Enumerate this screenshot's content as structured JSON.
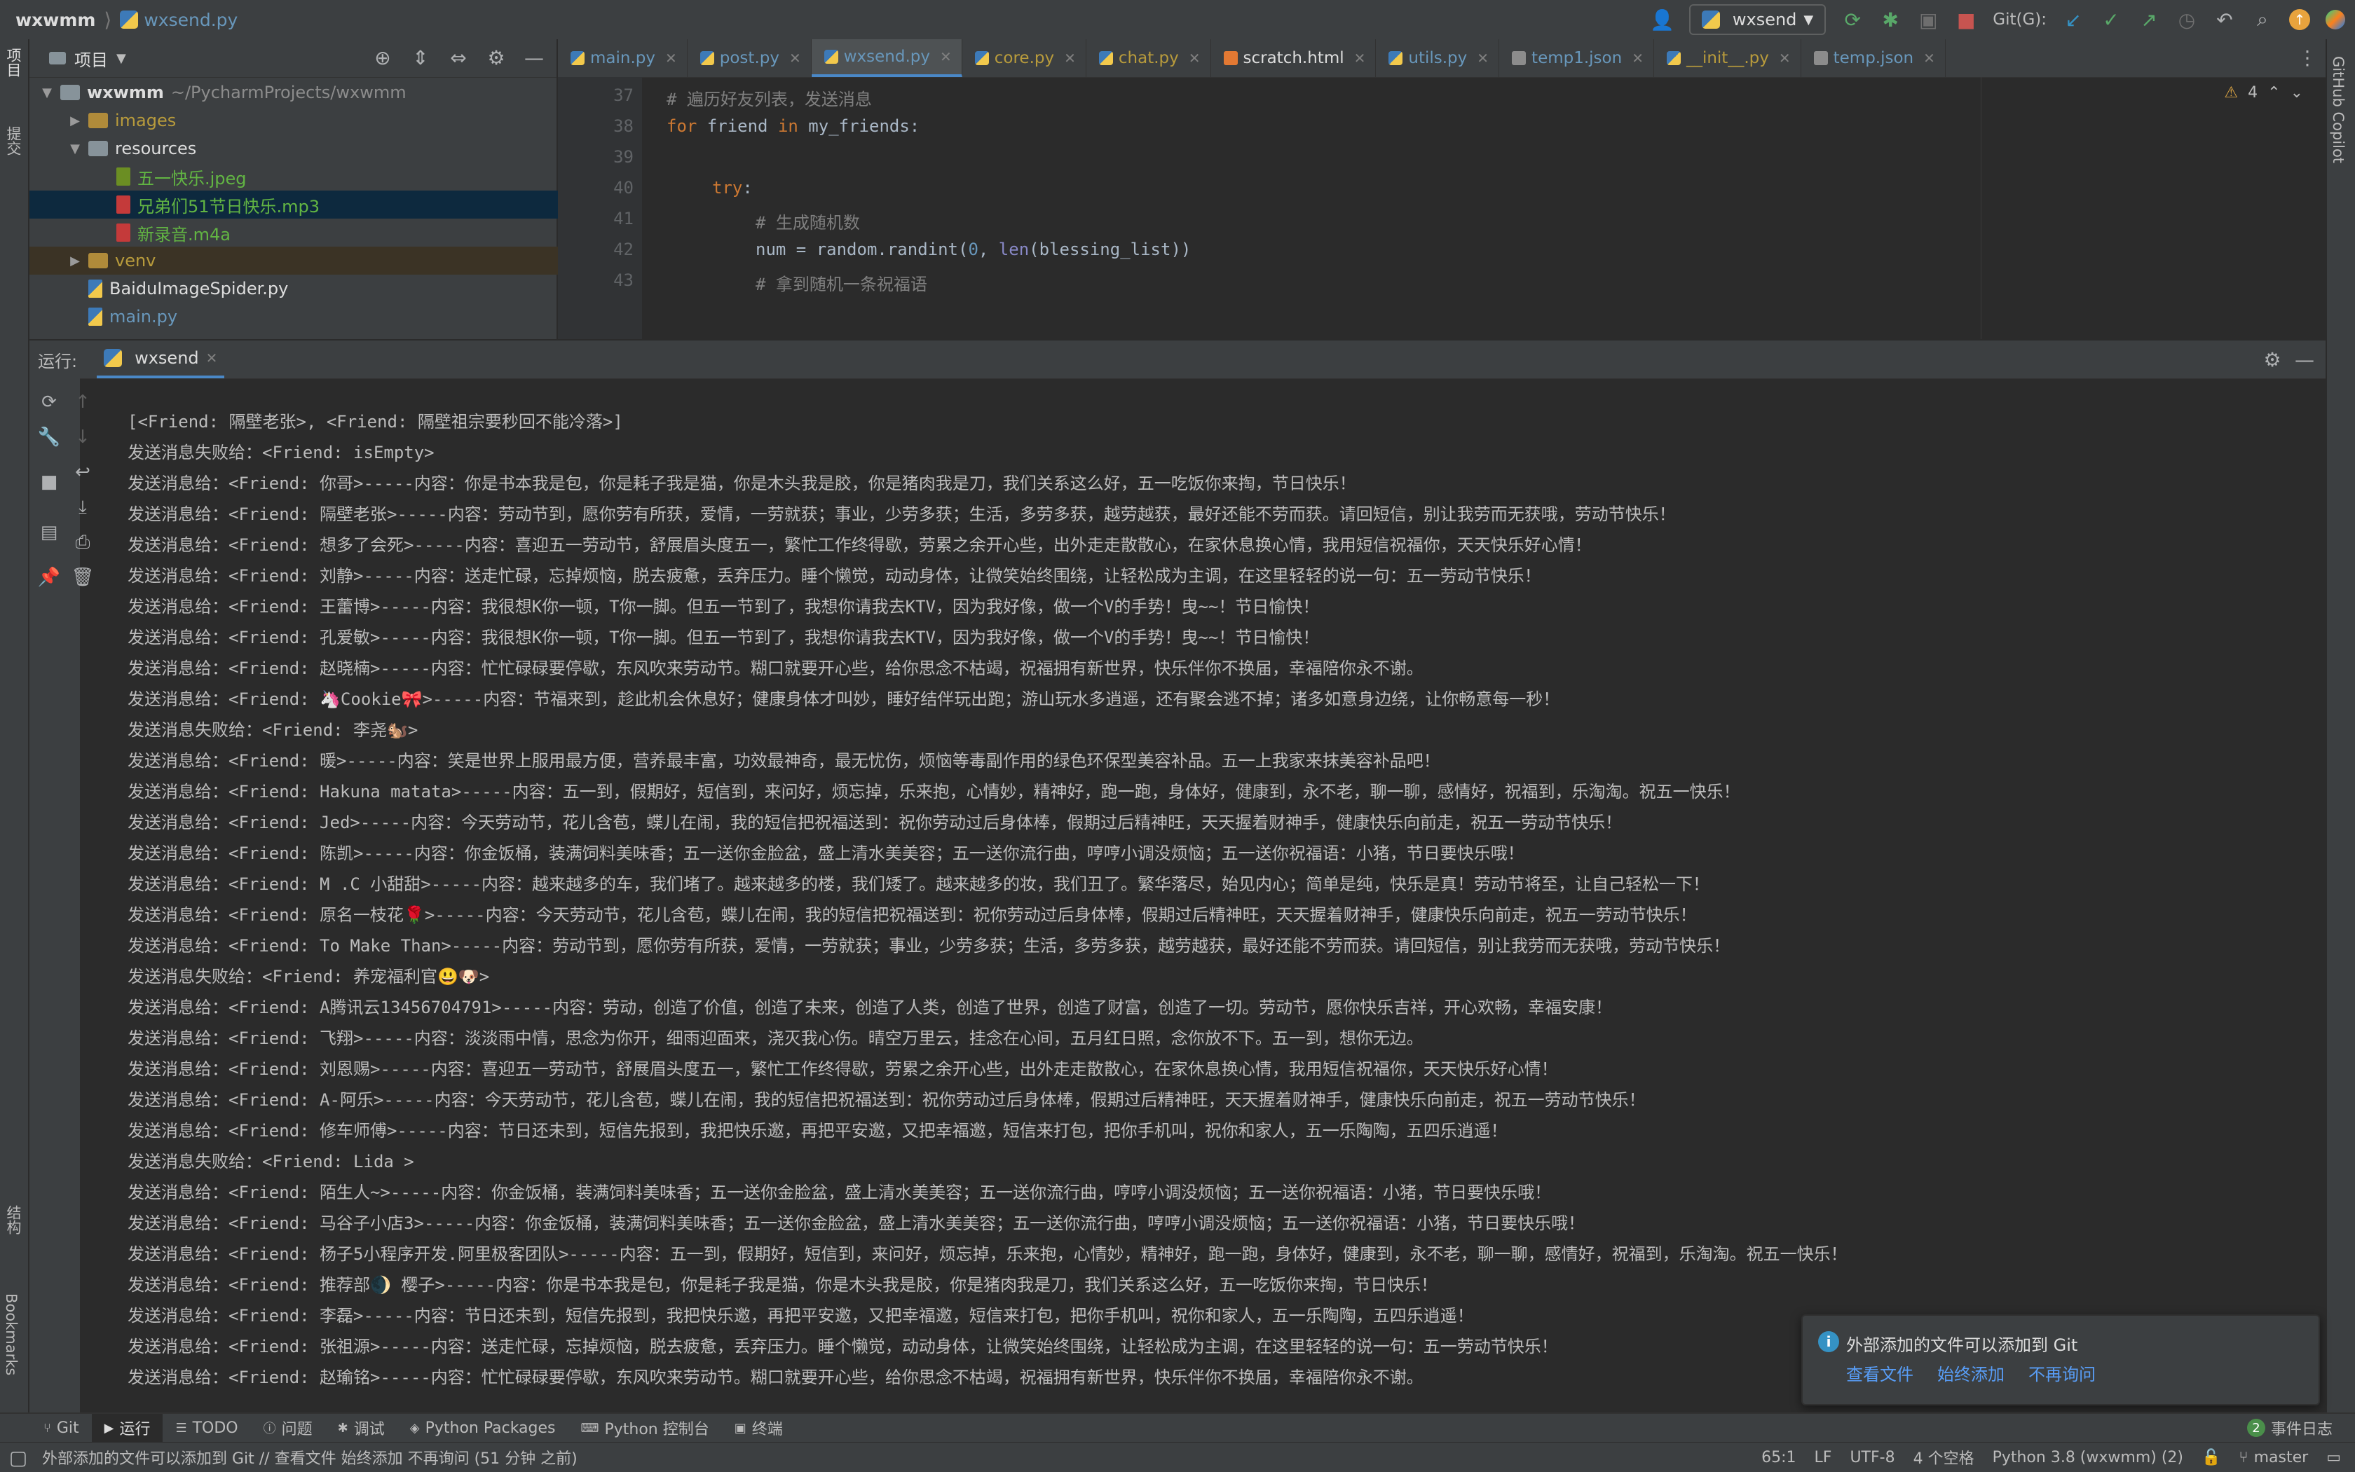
{
  "titlebar": {
    "project": "wxwmm",
    "file": "wxsend.py",
    "run_config": "wxsend",
    "git_label": "Git(G):"
  },
  "side_labels": {
    "project": "项目",
    "commit": "提交",
    "structure": "结构",
    "bookmarks": "Bookmarks",
    "copilot": "GitHub Copilot"
  },
  "project_panel": {
    "title": "项目",
    "tree": [
      {
        "label": "wxwmm",
        "extra": "~/PycharmProjects/wxwmm",
        "depth": 0,
        "type": "folder",
        "expanded": true
      },
      {
        "label": "images",
        "depth": 1,
        "type": "folder-yellow",
        "expanded": false
      },
      {
        "label": "resources",
        "depth": 1,
        "type": "folder",
        "expanded": true
      },
      {
        "label": "五一快乐.jpeg",
        "depth": 2,
        "type": "image"
      },
      {
        "label": "兄弟们51节日快乐.mp3",
        "depth": 2,
        "type": "audio",
        "selected": true
      },
      {
        "label": "新录音.m4a",
        "depth": 2,
        "type": "audio"
      },
      {
        "label": "venv",
        "depth": 1,
        "type": "folder-yellow",
        "expanded": false,
        "highlight": true
      },
      {
        "label": "BaiduImageSpider.py",
        "depth": 1,
        "type": "py"
      },
      {
        "label": "main.py",
        "depth": 1,
        "type": "py"
      }
    ]
  },
  "editor": {
    "tabs": [
      {
        "label": "main.py",
        "icon": "py"
      },
      {
        "label": "post.py",
        "icon": "py"
      },
      {
        "label": "wxsend.py",
        "icon": "py",
        "active": true
      },
      {
        "label": "core.py",
        "icon": "py"
      },
      {
        "label": "chat.py",
        "icon": "py"
      },
      {
        "label": "scratch.html",
        "icon": "html"
      },
      {
        "label": "utils.py",
        "icon": "py"
      },
      {
        "label": "temp1.json",
        "icon": "json"
      },
      {
        "label": "__init__.py",
        "icon": "py"
      },
      {
        "label": "temp.json",
        "icon": "json"
      }
    ],
    "warning_count": "4",
    "line_numbers": [
      "37",
      "38",
      "39",
      "40",
      "41",
      "42",
      "43"
    ],
    "lines": {
      "l37": "# 遍历好友列表，发送消息",
      "l38_kw1": "for",
      "l38_mid": " friend ",
      "l38_kw2": "in",
      "l38_end": " my_friends:",
      "l40_kw": "try",
      "l40_end": ":",
      "l41": "# 生成随机数",
      "l42_a": "num = random.randint(",
      "l42_b": "0",
      "l42_c": ", ",
      "l42_d": "len",
      "l42_e": "(blessing_list))",
      "l43": "# 拿到随机一条祝福语"
    }
  },
  "run_panel": {
    "label": "运行:",
    "tab": "wxsend",
    "lines": [
      "[<Friend: 隔壁老张>, <Friend: 隔壁祖宗要秒回不能冷落>]",
      "发送消息失败给：<Friend: isEmpty>",
      "发送消息给：<Friend: 你哥>-----内容：你是书本我是包，你是耗子我是猫，你是木头我是胶，你是猪肉我是刀，我们关系这么好，五一吃饭你来掏，节日快乐！",
      "发送消息给：<Friend: 隔壁老张>-----内容：劳动节到，愿你劳有所获，爱情，一劳就获；事业，少劳多获；生活，多劳多获，越劳越获，最好还能不劳而获。请回短信，别让我劳而无获哦，劳动节快乐！",
      "发送消息给：<Friend: 想多了会死>-----内容：喜迎五一劳动节，舒展眉头度五一，繁忙工作终得歇，劳累之余开心些，出外走走散散心，在家休息换心情，我用短信祝福你，天天快乐好心情！",
      "发送消息给：<Friend: 刘静>-----内容：送走忙碌，忘掉烦恼，脱去疲惫，丢弃压力。睡个懒觉，动动身体，让微笑始终围绕，让轻松成为主调，在这里轻轻的说一句：五一劳动节快乐！",
      "发送消息给：<Friend: 王蕾博>-----内容：我很想K你一顿，T你一脚。但五一节到了，我想你请我去KTV，因为我好像，做一个V的手势！曳~~！节日愉快！",
      "发送消息给：<Friend: 孔爱敏>-----内容：我很想K你一顿，T你一脚。但五一节到了，我想你请我去KTV，因为我好像，做一个V的手势！曳~~！节日愉快！",
      "发送消息给：<Friend: 赵晓楠>-----内容：忙忙碌碌要停歇，东风吹来劳动节。糊口就要开心些，给你思念不枯竭，祝福拥有新世界，快乐伴你不换届，幸福陪你永不谢。",
      "发送消息给：<Friend: 🦄Cookie🎀>-----内容：节福来到，趁此机会休息好；健康身体才叫妙，睡好结伴玩出跑；游山玩水多逍遥，还有聚会逃不掉；诸多如意身边绕，让你畅意每一秒！",
      "发送消息失败给：<Friend: 李尧🐿️>",
      "发送消息给：<Friend: 暖>-----内容：笑是世界上服用最方便，营养最丰富，功效最神奇，最无忧伤，烦恼等毒副作用的绿色环保型美容补品。五一上我家来抹美容补品吧！",
      "发送消息给：<Friend: Hakuna matata>-----内容：五一到，假期好，短信到，来问好，烦忘掉，乐来抱，心情妙，精神好，跑一跑，身体好，健康到，永不老，聊一聊，感情好，祝福到，乐淘淘。祝五一快乐！",
      "发送消息给：<Friend: Jed>-----内容：今天劳动节，花儿含苞，蝶儿在闹，我的短信把祝福送到：祝你劳动过后身体棒，假期过后精神旺，天天握着财神手，健康快乐向前走，祝五一劳动节快乐！",
      "发送消息给：<Friend: 陈凯>-----内容：你金饭桶，装满饲料美味香；五一送你金脸盆，盛上清水美美容；五一送你流行曲，哼哼小调没烦恼；五一送你祝福语：小猪，节日要快乐哦！",
      "发送消息给：<Friend: M .C  小甜甜>-----内容：越来越多的车，我们堵了。越来越多的楼，我们矮了。越来越多的妆，我们丑了。繁华落尽，始见内心；简单是纯，快乐是真！劳动节将至，让自己轻松一下！",
      "发送消息给：<Friend: 原名一枝花🌹>-----内容：今天劳动节，花儿含苞，蝶儿在闹，我的短信把祝福送到：祝你劳动过后身体棒，假期过后精神旺，天天握着财神手，健康快乐向前走，祝五一劳动节快乐！",
      "发送消息给：<Friend: To Make Than>-----内容：劳动节到，愿你劳有所获，爱情，一劳就获；事业，少劳多获；生活，多劳多获，越劳越获，最好还能不劳而获。请回短信，别让我劳而无获哦，劳动节快乐！",
      "发送消息失败给：<Friend: 养宠福利官😃🐶>",
      "发送消息给：<Friend: A腾讯云13456704791>-----内容：劳动，创造了价值，创造了未来，创造了人类，创造了世界，创造了财富，创造了一切。劳动节，愿你快乐吉祥，开心欢畅，幸福安康！",
      "发送消息给：<Friend: 飞翔>-----内容：淡淡雨中情，思念为你开，细雨迎面来，浇灭我心伤。晴空万里云，挂念在心间，五月红日照，念你放不下。五一到，想你无边。",
      "发送消息给：<Friend: 刘恩赐>-----内容：喜迎五一劳动节，舒展眉头度五一，繁忙工作终得歇，劳累之余开心些，出外走走散散心，在家休息换心情，我用短信祝福你，天天快乐好心情！",
      "发送消息给：<Friend: A-阿乐>-----内容：今天劳动节，花儿含苞，蝶儿在闹，我的短信把祝福送到：祝你劳动过后身体棒，假期过后精神旺，天天握着财神手，健康快乐向前走，祝五一劳动节快乐！",
      "发送消息给：<Friend: 修车师傅>-----内容：节日还未到，短信先报到，我把快乐邀，再把平安邀，又把幸福邀，短信来打包，把你手机叫，祝你和家人，五一乐陶陶，五四乐逍遥！",
      "发送消息失败给：<Friend: Lida >",
      "发送消息给：<Friend: 陌生人~>-----内容：你金饭桶，装满饲料美味香；五一送你金脸盆，盛上清水美美容；五一送你流行曲，哼哼小调没烦恼；五一送你祝福语：小猪，节日要快乐哦！",
      "发送消息给：<Friend: 马谷子小店3>-----内容：你金饭桶，装满饲料美味香；五一送你金脸盆，盛上清水美美容；五一送你流行曲，哼哼小调没烦恼；五一送你祝福语：小猪，节日要快乐哦！",
      "发送消息给：<Friend: 杨子5小程序开发.阿里极客团队>-----内容：五一到，假期好，短信到，来问好，烦忘掉，乐来抱，心情妙，精神好，跑一跑，身体好，健康到，永不老，聊一聊，感情好，祝福到，乐淘淘。祝五一快乐！",
      "发送消息给：<Friend: 推荐部🌒 樱子>-----内容：你是书本我是包，你是耗子我是猫，你是木头我是胶，你是猪肉我是刀，我们关系这么好，五一吃饭你来掏，节日快乐！",
      "发送消息给：<Friend: 李磊>-----内容：节日还未到，短信先报到，我把快乐邀，再把平安邀，又把幸福邀，短信来打包，把你手机叫，祝你和家人，五一乐陶陶，五四乐逍遥！",
      "发送消息给：<Friend: 张祖源>-----内容：送走忙碌，忘掉烦恼，脱去疲惫，丢弃压力。睡个懒觉，动动身体，让微笑始终围绕，让轻松成为主调，在这里轻轻的说一句：五一劳动节快乐！",
      "发送消息给：<Friend: 赵瑜铭>-----内容：忙忙碌碌要停歇，东风吹来劳动节。糊口就要开心些，给你思念不枯竭，祝福拥有新世界，快乐伴你不换届，幸福陪你永不谢。"
    ]
  },
  "notification": {
    "message": "外部添加的文件可以添加到 Git",
    "actions": [
      "查看文件",
      "始终添加",
      "不再询问"
    ]
  },
  "bottom_tabs": [
    {
      "label": "Git",
      "icon": "git-icon"
    },
    {
      "label": "运行",
      "icon": "run-icon",
      "active": true
    },
    {
      "label": "TODO",
      "icon": "todo-icon"
    },
    {
      "label": "问题",
      "icon": "problems-icon"
    },
    {
      "label": "调试",
      "icon": "debug-icon"
    },
    {
      "label": "Python Packages",
      "icon": "packages-icon"
    },
    {
      "label": "Python 控制台",
      "icon": "python-console-icon"
    },
    {
      "label": "终端",
      "icon": "terminal-icon"
    }
  ],
  "event_log": {
    "count": "2",
    "label": "事件日志"
  },
  "statusbar": {
    "message": "外部添加的文件可以添加到 Git // 查看文件   始终添加   不再询问 (51 分钟 之前)",
    "position": "65:1",
    "line_sep": "LF",
    "encoding": "UTF-8",
    "indent": "4 个空格",
    "interpreter": "Python 3.8 (wxwmm) (2)",
    "branch": "master"
  },
  "colors": {
    "bg": "#2b2b2b",
    "panel": "#3c3f41",
    "accent": "#4a88c7",
    "selection": "#0d293e",
    "link": "#589df6"
  }
}
